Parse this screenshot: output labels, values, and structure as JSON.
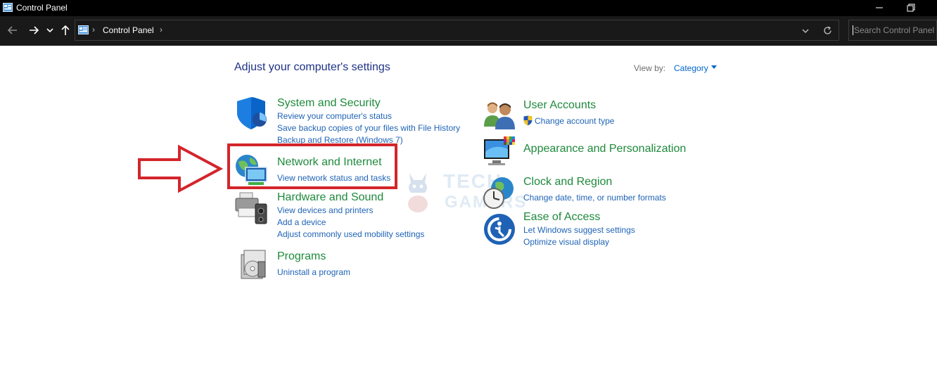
{
  "window": {
    "title": "Control Panel"
  },
  "navbar": {
    "breadcrumb": "Control Panel",
    "search_placeholder": "Search Control Panel"
  },
  "content": {
    "heading": "Adjust your computer's settings",
    "view_by_label": "View by:",
    "view_by_value": "Category",
    "categories": [
      {
        "title": "System and Security",
        "icon": "shield-icon",
        "links": [
          "Review your computer's status",
          "Save backup copies of your files with File History",
          "Backup and Restore (Windows 7)"
        ]
      },
      {
        "title": "Network and Internet",
        "icon": "network-globe-icon",
        "links": [
          "View network status and tasks"
        ]
      },
      {
        "title": "Hardware and Sound",
        "icon": "printer-speaker-icon",
        "links": [
          "View devices and printers",
          "Add a device",
          "Adjust commonly used mobility settings"
        ]
      },
      {
        "title": "Programs",
        "icon": "programs-disc-icon",
        "links": [
          "Uninstall a program"
        ]
      },
      {
        "title": "User Accounts",
        "icon": "users-icon",
        "links": [
          "Change account type"
        ]
      },
      {
        "title": "Appearance and Personalization",
        "icon": "monitor-palette-icon",
        "links": []
      },
      {
        "title": "Clock and Region",
        "icon": "clock-globe-icon",
        "links": [
          "Change date, time, or number formats"
        ]
      },
      {
        "title": "Ease of Access",
        "icon": "ease-of-access-icon",
        "links": [
          "Let Windows suggest settings",
          "Optimize visual display"
        ]
      }
    ]
  },
  "watermark": {
    "line1": "TECH",
    "line2": "GAMERS"
  },
  "colors": {
    "title_bar": "#000000",
    "nav_bar": "#191919",
    "heading": "#1e3287",
    "category_title": "#1e8a3c",
    "link": "#1f63b6",
    "highlight": "#d3252b"
  }
}
